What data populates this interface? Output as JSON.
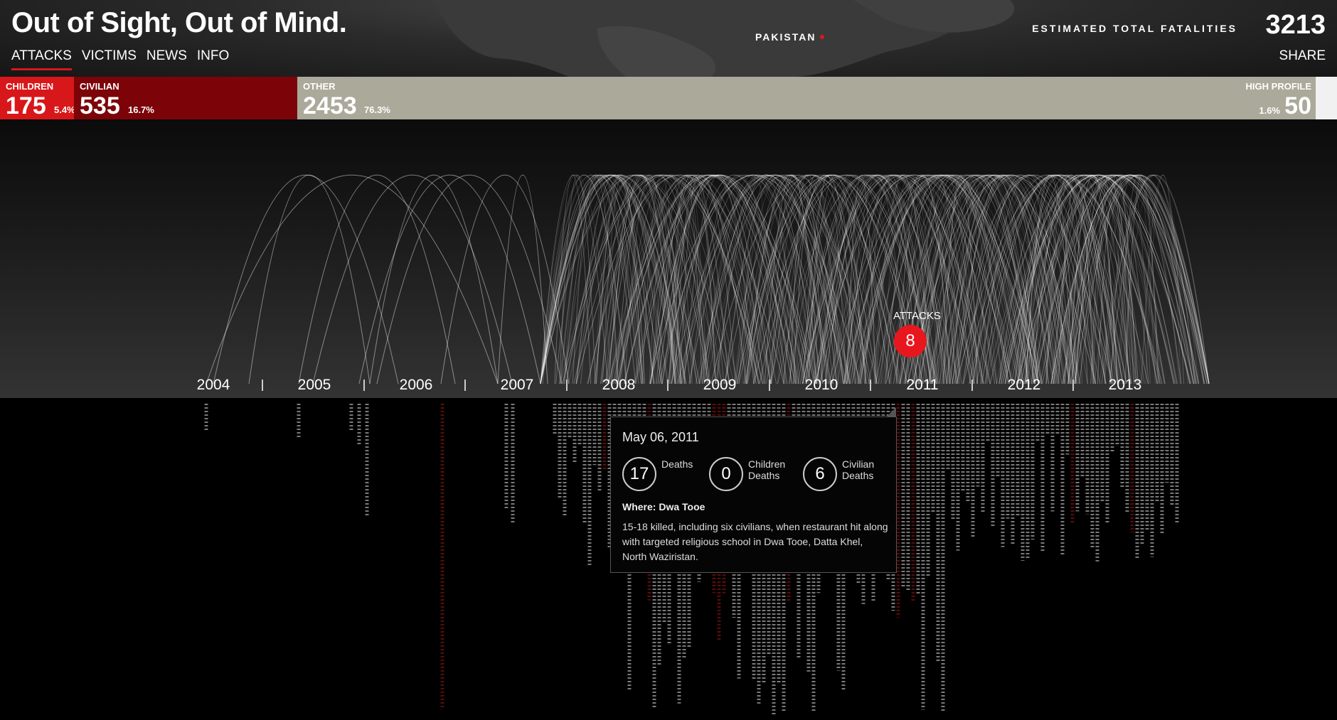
{
  "header": {
    "title": "Out of Sight, Out of Mind.",
    "nav": [
      {
        "label": "ATTACKS",
        "active": true
      },
      {
        "label": "VICTIMS",
        "active": false
      },
      {
        "label": "NEWS",
        "active": false
      },
      {
        "label": "INFO",
        "active": false
      }
    ],
    "map_label": "PAKISTAN",
    "fatalities_label": "ESTIMATED TOTAL FATALITIES",
    "fatalities_value": "3213",
    "share_label": "SHARE"
  },
  "categories": {
    "children": {
      "label": "CHILDREN",
      "value": "175",
      "pct": "5.4%"
    },
    "civilian": {
      "label": "CIVILIAN",
      "value": "535",
      "pct": "16.7%"
    },
    "other": {
      "label": "OTHER",
      "value": "2453",
      "pct": "76.3%"
    },
    "high_profile": {
      "label": "HIGH PROFILE",
      "value": "50",
      "pct": "1.6%"
    }
  },
  "timeline": {
    "years": [
      "2004",
      "2005",
      "2006",
      "2007",
      "2008",
      "2009",
      "2010",
      "2011",
      "2012",
      "2013"
    ]
  },
  "attack_marker": {
    "label": "ATTACKS",
    "count": "8"
  },
  "tooltip": {
    "date": "May 06, 2011",
    "deaths": "17",
    "deaths_label_1": "Deaths",
    "children_deaths": "0",
    "children_label_1": "Children",
    "children_label_2": "Deaths",
    "civilian_deaths": "6",
    "civilian_label_1": "Civilian",
    "civilian_label_2": "Deaths",
    "where": "Where: Dwa Tooe",
    "description": "15-18 killed, including six civilians, when restaurant hit along with targeted religious school in Dwa Tooe, Datta Khel, North Waziristan."
  },
  "colors": {
    "children": "#d8171a",
    "civilian": "#7c0408",
    "other": "#aaa99a",
    "high_profile": "#f1f1f1",
    "accent": "#e8171d"
  }
}
